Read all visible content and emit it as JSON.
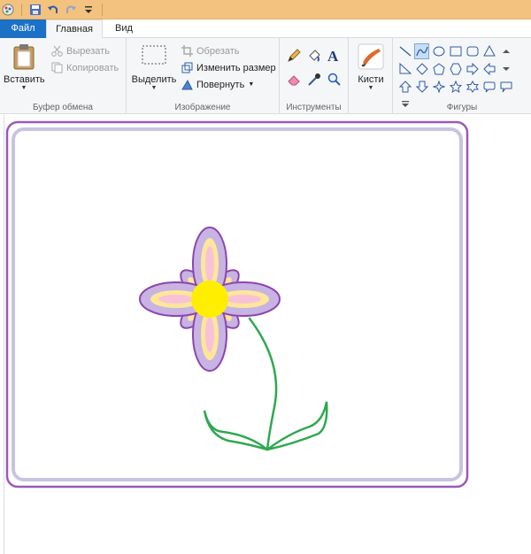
{
  "quick_access": {
    "icons": [
      "paint-app-icon",
      "save-icon",
      "undo-icon",
      "redo-icon",
      "customize-qat-icon"
    ]
  },
  "tabs": {
    "file": "Файл",
    "home": "Главная",
    "view": "Вид"
  },
  "ribbon": {
    "clipboard": {
      "paste": "Вставить",
      "cut": "Вырезать",
      "copy": "Копировать",
      "label": "Буфер обмена"
    },
    "image": {
      "select": "Выделить",
      "crop": "Обрезать",
      "resize": "Изменить размер",
      "rotate": "Повернуть",
      "label": "Изображение"
    },
    "tools": {
      "label": "Инструменты"
    },
    "brushes": {
      "label": "Кисти"
    },
    "shapes": {
      "label": "Фигуры"
    }
  },
  "colors": {
    "accent": "#1b71c6",
    "frame_outer": "#9b59b6",
    "frame_inner": "#c7c4e0",
    "petal_outer": "#c7b4e3",
    "petal_inner_yellow": "#ffe69a",
    "petal_pink": "#f7c2d8",
    "center": "#ffee00",
    "stem": "#2fa84f"
  }
}
